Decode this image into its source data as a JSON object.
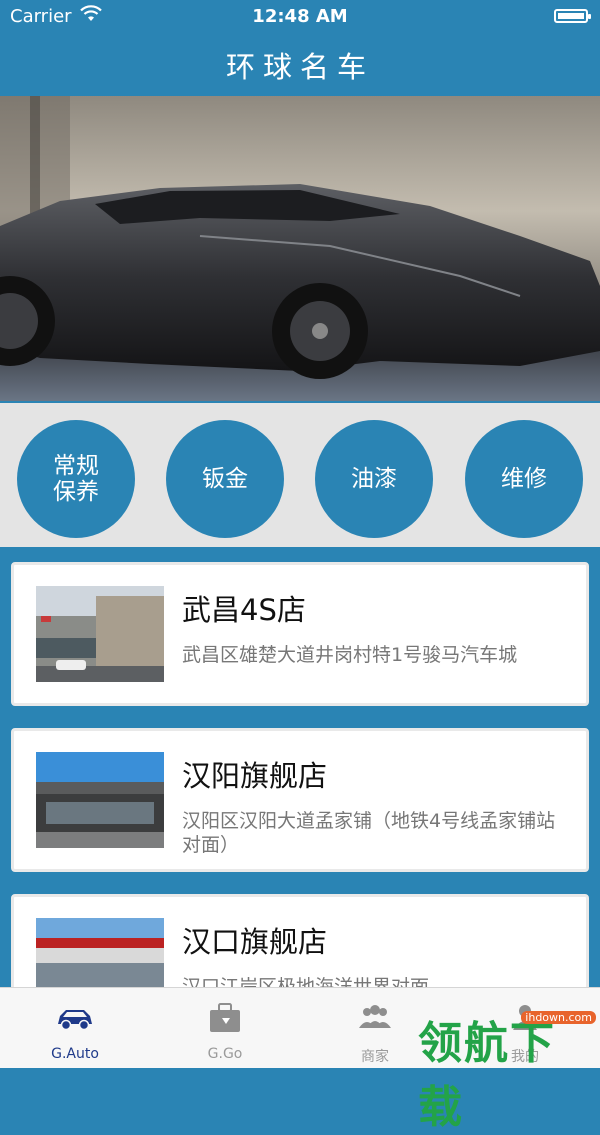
{
  "status_bar": {
    "carrier": "Carrier",
    "time": "12:48 AM"
  },
  "nav": {
    "title": "环球名车"
  },
  "categories": [
    {
      "label": "常规保养"
    },
    {
      "label": "钣金"
    },
    {
      "label": "油漆"
    },
    {
      "label": "维修"
    }
  ],
  "stores": [
    {
      "name": "武昌4S店",
      "address": "武昌区雄楚大道井岗村特1号骏马汽车城"
    },
    {
      "name": "汉阳旗舰店",
      "address": "汉阳区汉阳大道孟家铺（地铁4号线孟家铺站对面）"
    },
    {
      "name": "汉口旗舰店",
      "address": "汉口江岸区极地海洋世界对面"
    }
  ],
  "tabs": [
    {
      "label": "G.Auto",
      "icon": "car-icon",
      "active": true
    },
    {
      "label": "G.Go",
      "icon": "briefcase-icon",
      "active": false
    },
    {
      "label": "商家",
      "icon": "people-icon",
      "active": false
    },
    {
      "label": "我的",
      "icon": "person-icon",
      "active": false
    }
  ],
  "watermark": {
    "text": "领航下载",
    "url": "ihdown.com"
  },
  "colors": {
    "brand": "#2A84B4",
    "tab_active": "#1f3a8a",
    "tab_inactive": "#9a9a9a"
  }
}
